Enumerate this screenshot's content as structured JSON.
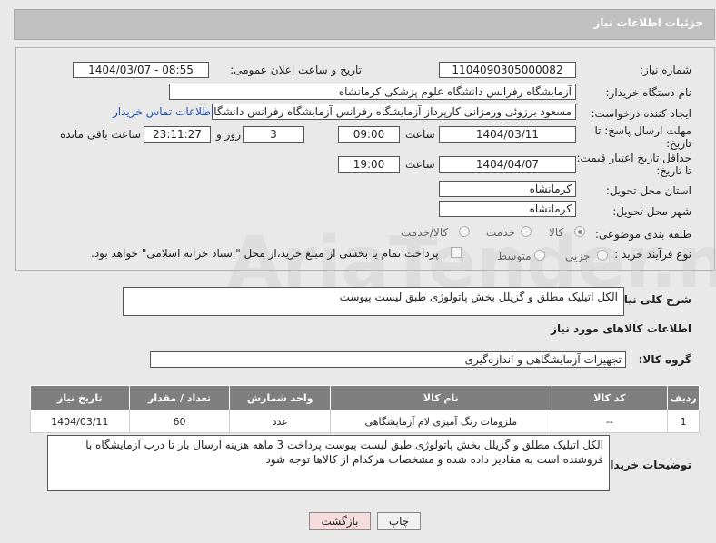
{
  "header": {
    "title": "جزئیات اطلاعات نیاز"
  },
  "form": {
    "need_number_label": "شماره نیاز:",
    "need_number": "1104090305000082",
    "announce_label": "تاریخ و ساعت اعلان عمومی:",
    "announce_value": "1404/03/07 - 08:55",
    "buyer_org_label": "نام دستگاه خریدار:",
    "buyer_org": "آزمایشگاه رفرانس دانشگاه علوم پزشکی کرمانشاه",
    "creator_label": "ایجاد کننده درخواست:",
    "creator": "مسعود برزوئی ورمزانی کارپرداز آزمایشگاه رفرانس آزمایشگاه رفرانس دانشگاه ع",
    "contact_link": "اطلاعات تماس خریدار",
    "deadline_label_1": "مهلت ارسال پاسخ: تا",
    "deadline_label_2": "تاریخ:",
    "deadline_date": "1404/03/11",
    "time_label": "ساعت",
    "deadline_time": "09:00",
    "days_value": "3",
    "days_label": "روز و",
    "remaining_time": "23:11:27",
    "remaining_label": "ساعت باقی مانده",
    "validity_label_1": "حداقل تاریخ اعتبار قیمت:",
    "validity_label_2": "تا تاریخ:",
    "validity_date": "1404/04/07",
    "validity_time": "19:00",
    "province_label": "استان محل تحویل:",
    "province": "کرمانشاه",
    "city_label": "شهر محل تحویل:",
    "city": "کرمانشاه",
    "category_label": "طبقه بندی موضوعی:",
    "category_options": [
      "کالا",
      "خدمت",
      "کالا/خدمت"
    ],
    "category_selected": "کالا",
    "purchase_type_label": "نوع فرآیند خرید :",
    "purchase_options": [
      "جزیی",
      "متوسط"
    ],
    "purchase_note": "پرداخت تمام یا بخشی از مبلغ خرید،از محل \"اسناد خزانه اسلامی\" خواهد بود."
  },
  "summary": {
    "label": "شرح کلی نیاز:",
    "text": "الکل اتیلیک مطلق  و گزیلل بخش پاتولوژی طبق لیست پیوست"
  },
  "goods_section": {
    "title": "اطلاعات کالاهای مورد نیاز",
    "group_label": "گروه کالا:",
    "group_value": "تجهیزات آزمایشگاهی و اندازه‌گیری"
  },
  "table": {
    "headers": [
      "ردیف",
      "کد کالا",
      "نام کالا",
      "واحد شمارش",
      "تعداد / مقدار",
      "تاریخ نیاز"
    ],
    "rows": [
      {
        "row": "1",
        "code": "--",
        "name": "ملزومات رنگ آمیزی لام آزمایشگاهی",
        "unit": "عدد",
        "qty": "60",
        "date": "1404/03/11"
      }
    ]
  },
  "buyer_notes": {
    "label": "توضیحات خریدار:",
    "text": "الکل اتیلیک مطلق  و گزیلل بخش پاتولوژی طبق لیست پیوست پرداخت 3 ماهه هزینه ارسال بار تا درب آزمایشگاه با فروشنده است به مقادیر داده شده و مشخصات هرکدام از کالاها توجه شود"
  },
  "buttons": {
    "print": "چاپ",
    "back": "بازگشت"
  },
  "watermark": "AriaTender.net"
}
